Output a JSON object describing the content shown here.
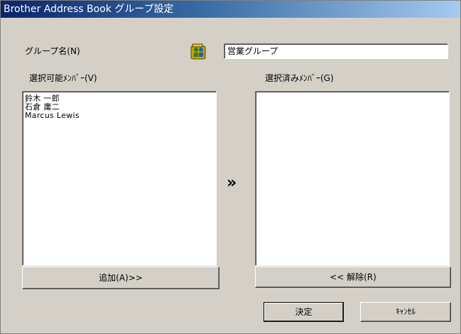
{
  "window": {
    "title": "Brother Address Book グループ設定"
  },
  "group_name": {
    "label": "グループ名(N)",
    "icon": "group-icon",
    "value": "営業グループ"
  },
  "available_members": {
    "label": "選択可能ﾒﾝﾊﾞｰ(V)",
    "items": [
      "鈴木 一郎",
      "石倉 庸二",
      "Marcus Lewis"
    ]
  },
  "selected_members": {
    "label": "選択済みﾒﾝﾊﾞｰ(G)",
    "items": []
  },
  "transfer_indicator": "»",
  "buttons": {
    "add": "追加(A)>>",
    "remove": "<< 解除(R)",
    "ok": "決定",
    "cancel": "ｷｬﾝｾﾙ"
  }
}
